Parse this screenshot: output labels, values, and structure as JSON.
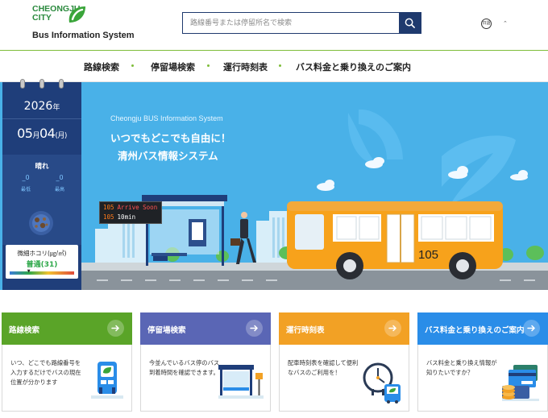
{
  "header": {
    "logo": {
      "city": "CHEONGJU\nCITY",
      "system_name": "Bus Information System"
    },
    "search": {
      "placeholder": "路線番号または停留所名で検索"
    },
    "language": {
      "label": "日語"
    }
  },
  "nav": {
    "items": [
      {
        "label": "路線検索"
      },
      {
        "label": "停留場検索"
      },
      {
        "label": "運行時刻表"
      },
      {
        "label": "バス料金と乗り換えのご案内"
      }
    ]
  },
  "calendar": {
    "year": "2026",
    "year_unit": "年",
    "month": "05",
    "month_unit": "月",
    "day": "04",
    "weekday": "(月)",
    "weather": "晴れ",
    "temp_low": "_0",
    "temp_low_label": "最低",
    "temp_high": "_0",
    "temp_high_label": "最高",
    "dust_label": "微細ホコリ(㎍/㎥)",
    "dust_value": "普通(31)",
    "dust_level_fraction": 0.31
  },
  "hero": {
    "subtitle": "Cheongju BUS Information System",
    "title_line1": "いつでもどこでも自由に！",
    "title_line2": "清州バス情報システム",
    "arrival_board": [
      {
        "route": "105",
        "status": "Arrive Soon"
      },
      {
        "route": "105",
        "status": "10min"
      }
    ],
    "bus_number": "105"
  },
  "cards": [
    {
      "title": "路線検索",
      "description": "いつ、どこでも路線番号を入力するだけでバスの現在位置が分かります",
      "color": "#5aa428",
      "icon": "bus-stop-sign-icon"
    },
    {
      "title": "停留場検索",
      "description": "今並んでいるバス停のバス到着時間を確認できます。",
      "color": "#5a66b5",
      "icon": "bus-shelter-icon"
    },
    {
      "title": "運行時刻表",
      "description": "配車時刻表を確認して便利なバスのご利用を！",
      "color": "#f2a125",
      "icon": "clock-bus-icon"
    },
    {
      "title": "バス料金と乗り換えのご案内",
      "description": "バス料金と乗り換え情報が知りたいですか？",
      "color": "#2a8de8",
      "icon": "card-coins-icon"
    }
  ],
  "colors": {
    "brand_green": "#7ebd3a",
    "navy": "#1f3a6e",
    "hero_blue": "#49b1e8",
    "bus_orange": "#f7a21b"
  }
}
